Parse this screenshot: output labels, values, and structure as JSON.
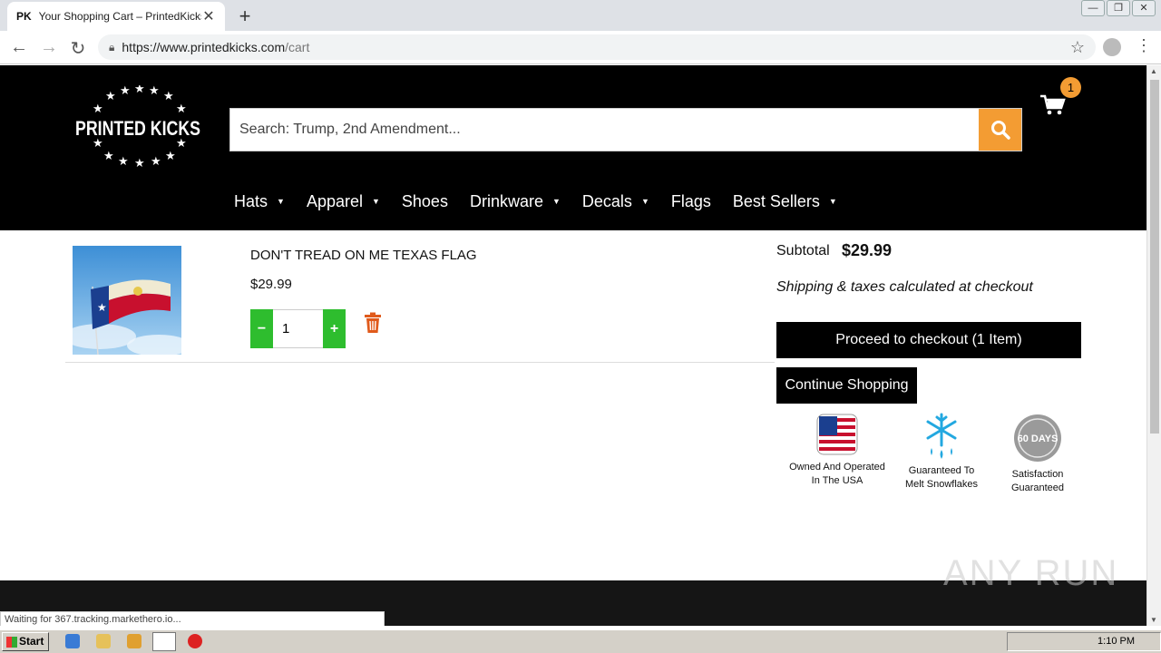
{
  "browser": {
    "tab_favicon": "PK",
    "tab_title": "Your Shopping Cart – PrintedKicks",
    "tab_close": "✕",
    "new_tab": "+",
    "url_main": "https://www.printedkicks.com",
    "url_path": "/cart",
    "window_buttons": [
      "—",
      "❐",
      "✕"
    ]
  },
  "site": {
    "logo_text": "PRINTED KICKS",
    "search_placeholder": "Search: Trump, 2nd Amendment...",
    "cart_count": "1",
    "accent_color": "#f39c33",
    "nav": [
      {
        "label": "Hats",
        "caret": "▼"
      },
      {
        "label": "Apparel",
        "caret": "▼"
      },
      {
        "label": "Shoes",
        "caret": ""
      },
      {
        "label": "Drinkware",
        "caret": "▼"
      },
      {
        "label": "Decals",
        "caret": "▼"
      },
      {
        "label": "Flags",
        "caret": ""
      },
      {
        "label": "Best Sellers",
        "caret": "▼"
      }
    ]
  },
  "cart": {
    "item": {
      "name": "DON'T TREAD ON ME TEXAS FLAG",
      "price": "$29.99",
      "quantity": "1",
      "minus": "−",
      "plus": "+"
    },
    "subtotal_label": "Subtotal",
    "subtotal_value": "$29.99",
    "shipping_note": "Shipping & taxes calculated at checkout",
    "checkout_label": "Proceed to checkout (1 Item)",
    "continue_label": "Continue Shopping",
    "badges": [
      {
        "line1": "Owned And Operated",
        "line2": "In The USA"
      },
      {
        "line1": "Guaranteed To",
        "line2": "Melt Snowflakes"
      },
      {
        "line1": "Satisfaction",
        "line2": "Guaranteed",
        "seal": "60 DAYS"
      }
    ]
  },
  "status_text": "Waiting for 367.tracking.markethero.io...",
  "watermark": "ANY RUN",
  "taskbar": {
    "start_label": "Start",
    "clock": "1:10 PM"
  }
}
